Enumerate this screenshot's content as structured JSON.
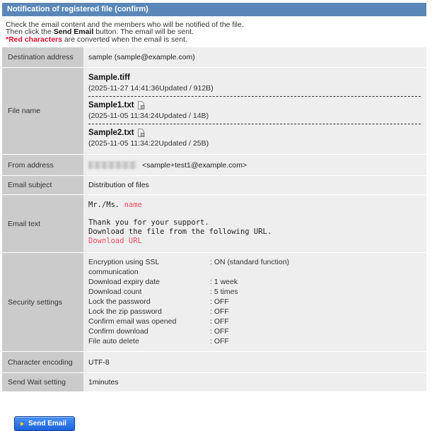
{
  "header": {
    "title": "Notification of registered file (confirm)"
  },
  "intro": {
    "line1": "Check the email content and the members who will be notified of the file.",
    "line2_pre": "Then click the ",
    "line2_bold": "Send Email",
    "line2_post": " button. The email will be sent.",
    "line3_red": "*Red characters",
    "line3_post": " are converted when the email is sent."
  },
  "table": {
    "destination": {
      "label": "Destination address",
      "value": "sample (sample@example.com)"
    },
    "file_name": {
      "label": "File name",
      "files": [
        {
          "name": "Sample.tiff",
          "meta": "(2025-11-27 14:41:36Updated / 912B)",
          "locked": false
        },
        {
          "name": "Sample1.txt",
          "meta": "(2025-11-05 11:34:24Updated / 14B)",
          "locked": true
        },
        {
          "name": "Sample2.txt",
          "meta": "(2025-11-05 11:34:22Updated / 25B)",
          "locked": true
        }
      ]
    },
    "from": {
      "label": "From address",
      "value": "<sample+test1@example.com>"
    },
    "subject": {
      "label": "Email subject",
      "value": "Distribution of files"
    },
    "email_text": {
      "label": "Email text",
      "greeting_prefix": "Mr./Ms. ",
      "greeting_name": "name",
      "body_line1": "Thank you for your support.",
      "body_line2": "Download the file from the following URL.",
      "link_label": "Download URL"
    },
    "security": {
      "label": "Security settings",
      "items": [
        {
          "label": "Encryption using SSL communication",
          "value": "ON (standard function)"
        },
        {
          "label": "Download expiry date",
          "value": "1 week"
        },
        {
          "label": "Download count",
          "value": "5 times"
        },
        {
          "label": "Lock the password",
          "value": "OFF"
        },
        {
          "label": "Lock the zip password",
          "value": "OFF"
        },
        {
          "label": "Confirm email was opened",
          "value": "OFF"
        },
        {
          "label": "Confirm download",
          "value": "OFF"
        },
        {
          "label": "File auto delete",
          "value": "OFF"
        }
      ]
    },
    "encoding": {
      "label": "Character encoding",
      "value": "UTF-8"
    },
    "send_wait": {
      "label": "Send Wait setting",
      "value": "1minutes"
    }
  },
  "actions": {
    "send_button": "Send Email"
  },
  "colors": {
    "header_bg": "#5a87b8",
    "label_cell_bg": "#cbcbcb",
    "value_cell_bg": "#eeeeee",
    "alert_red": "#e60f33",
    "placeholder_red": "#ee4d63",
    "button_blue": "#1c63de",
    "button_arrow_yellow": "#ffd200"
  }
}
